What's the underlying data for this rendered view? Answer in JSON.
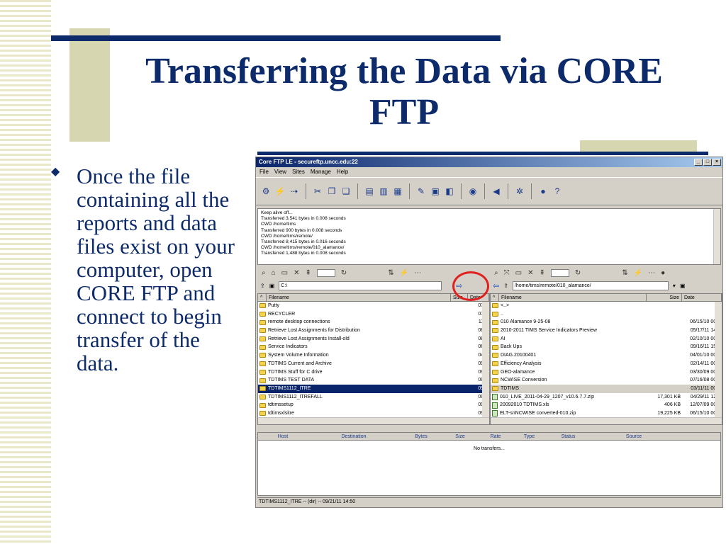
{
  "slide": {
    "title": "Transferring the Data via CORE FTP",
    "bullet": "Once the file containing all the reports and data files exist on your computer, open CORE FTP and connect to begin transfer of the data."
  },
  "window": {
    "title": "Core FTP LE - secureftp.uncc.edu:22",
    "menu": [
      "File",
      "View",
      "Sites",
      "Manage",
      "Help"
    ],
    "log": [
      "Keep alive off...",
      "Transferred 3,541 bytes in 0.008 seconds",
      "CWD /home/tims",
      "Transferred 900 bytes in 0.008 seconds",
      "CWD /home/tims/remote/",
      "Transferred 8,415 bytes in 0.016 seconds",
      "CWD /home/tims/remote/010_alamance/",
      "Transferred 1,488 bytes in 0.008 seconds"
    ],
    "local_path": "C:\\",
    "remote_path": "/home/tims/remote/010_alamance/",
    "local_headers": [
      "Filename",
      "Size",
      "Date"
    ],
    "remote_headers": [
      "Filename",
      "Size",
      "Date"
    ],
    "local_files": [
      {
        "name": "Putty",
        "date": "07/0"
      },
      {
        "name": "RECYCLER",
        "date": "07/1"
      },
      {
        "name": "remote desktop connections",
        "date": "11/2"
      },
      {
        "name": "Retrieve Lost Assignments for Distribution",
        "date": "08/2"
      },
      {
        "name": "Retrieve Lost Assignments Install-old",
        "date": "08/0"
      },
      {
        "name": "Service Indicators",
        "date": "06/0"
      },
      {
        "name": "System Volume Information",
        "date": "04/0"
      },
      {
        "name": "TDTIMS Current and Archive",
        "date": "09/1"
      },
      {
        "name": "TDTIMS Stuff for C drive",
        "date": "09/2"
      },
      {
        "name": "TDTIMS TEST DATA",
        "date": "09/2"
      },
      {
        "name": "TDTIMS1112_ITRE",
        "date": "09/2"
      },
      {
        "name": "TDTIMS1112_ITREFALL",
        "date": "09/2"
      },
      {
        "name": "tdtimssetup",
        "date": "09/2"
      },
      {
        "name": "tdtimsxlsitre",
        "date": "09/2"
      }
    ],
    "remote_files": [
      {
        "name": "<..>",
        "size": "",
        "date": ""
      },
      {
        "name": "..",
        "size": "",
        "date": ""
      },
      {
        "name": "010 Alamance 9-25-08",
        "size": "",
        "date": "06/15/10 00:0"
      },
      {
        "name": "2010-2011 TIMS Service Indicators Preview",
        "size": "",
        "date": "05/17/11 14:0"
      },
      {
        "name": "AI",
        "size": "",
        "date": "02/10/10 00:0"
      },
      {
        "name": "Back Ups",
        "size": "",
        "date": "09/16/11 15:4"
      },
      {
        "name": "DIAG.20100401",
        "size": "",
        "date": "04/01/10 00:0"
      },
      {
        "name": "Efficiency Analysis",
        "size": "",
        "date": "02/14/11 00:0"
      },
      {
        "name": "GEO-alamance",
        "size": "",
        "date": "03/30/09 00:0"
      },
      {
        "name": "NCWISE Conversion",
        "size": "",
        "date": "07/16/08 00:0"
      },
      {
        "name": "TDTIMS",
        "size": "",
        "date": "03/11/11 00:0"
      },
      {
        "name": "010_LIVE_2011-04-29_1207_v10.6.7.7.zip",
        "size": "17,301 KB",
        "date": "04/29/11 12:0"
      },
      {
        "name": "20092010 TDTIMS.xls",
        "size": "406 KB",
        "date": "12/07/09 00:0"
      },
      {
        "name": "ELT-snNCWISE converted-010.zip",
        "size": "19,225 KB",
        "date": "06/15/10 00:0"
      }
    ],
    "queue_headers": [
      "Host",
      "Destination",
      "Bytes",
      "Size",
      "Rate",
      "Type",
      "Status",
      "Source"
    ],
    "queue_message": "No transfers...",
    "status": "TDTIMS1112_ITRE -- (dir) -- 09/21/11  14:50"
  }
}
